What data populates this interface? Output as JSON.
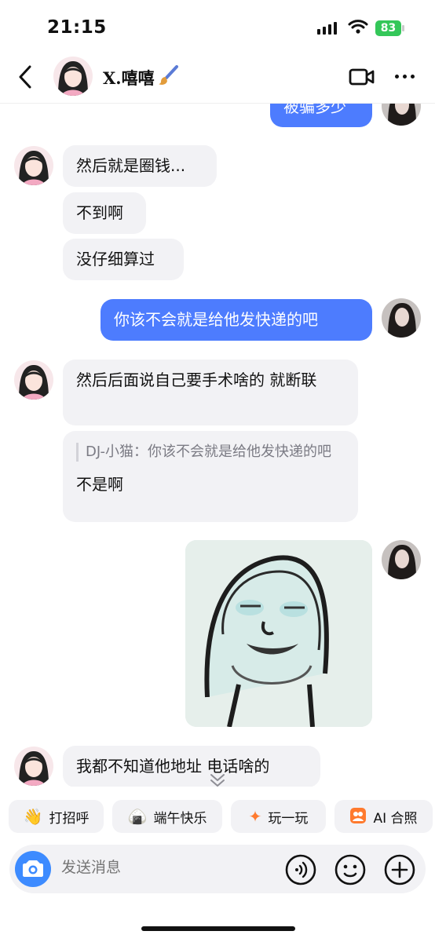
{
  "status": {
    "time": "21:15",
    "battery": "83"
  },
  "header": {
    "contact_name": "X.嘻嘻"
  },
  "messages": {
    "m0": "被骗多少",
    "m1": "然后就是圈钱...",
    "m2": "不到啊",
    "m3": "没仔细算过",
    "m4": "你该不会就是给他发快递的吧",
    "m5": "然后后面说自己要手术啥的 就断联",
    "m6_quote": "DJ-小猫：你该不会就是给他发快递的吧",
    "m6_text": "不是啊",
    "m8": "我都不知道他地址 电话啥的"
  },
  "quick_actions": {
    "greet": "打招呼",
    "festival": "端午快乐",
    "play": "玩一玩",
    "ai_photo": "AI 合照"
  },
  "composer": {
    "placeholder": "发送消息"
  },
  "colors": {
    "accent": "#4d7cfe",
    "incoming_bubble": "#f2f2f5",
    "battery": "#34c759",
    "camera_button": "#3d8bff"
  }
}
